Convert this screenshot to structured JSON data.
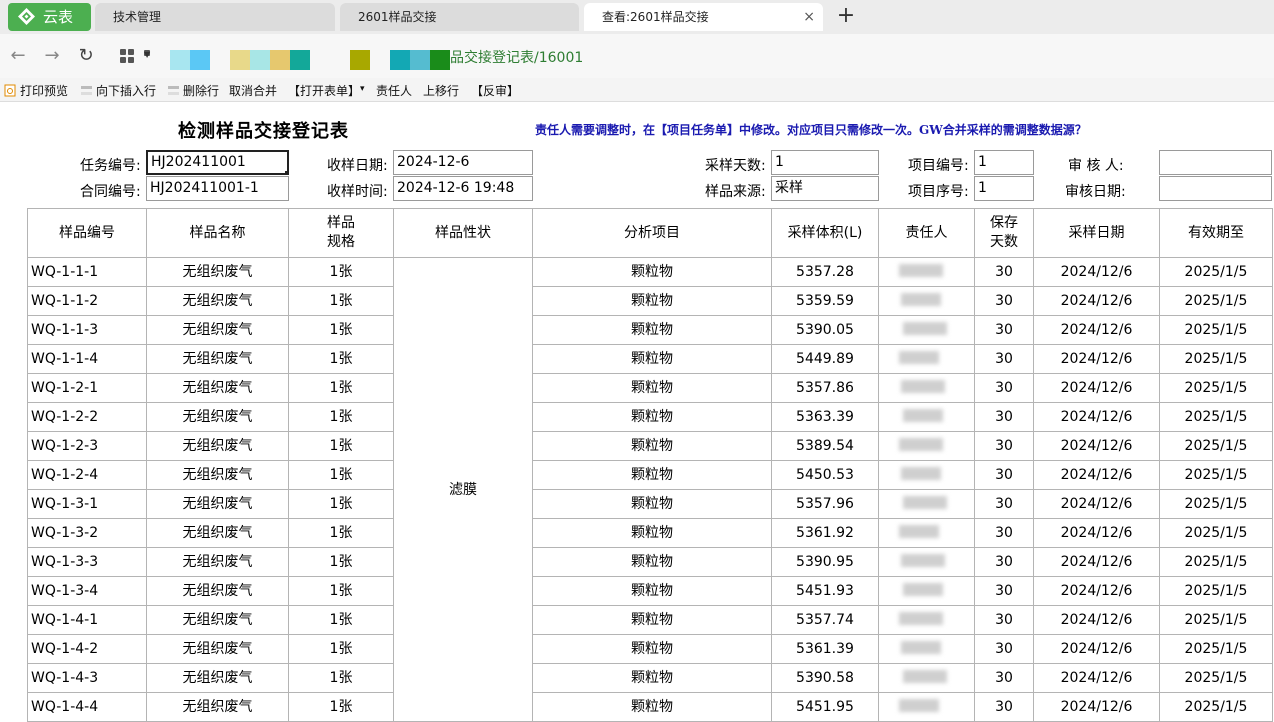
{
  "tabs": {
    "logo_text": "云表",
    "items": [
      {
        "label": "技术管理"
      },
      {
        "label": "2601样品交接"
      },
      {
        "label": "查看:2601样品交接"
      }
    ],
    "close_icon": "×",
    "new_tab_icon": "+"
  },
  "nav": {
    "back_icon": "←",
    "forward_icon": "→",
    "refresh_icon": "↻",
    "address": "品交接登记表/16001",
    "colors": [
      "#a8e6f0",
      "#5bc8f5",
      "#e8d98a",
      "#a8e6e6",
      "#e6c86e",
      "#13a899",
      "#a8a800",
      "#13a8b4",
      "#55bcd0",
      "#1eaa8c",
      "#1a8c1a"
    ]
  },
  "toolbar": {
    "items": [
      {
        "label": "打印预览",
        "icon": "print-preview-icon"
      },
      {
        "label": "向下插入行",
        "icon": "insert-row-icon"
      },
      {
        "label": "删除行",
        "icon": "delete-row-icon"
      },
      {
        "label": "取消合并"
      },
      {
        "label": "【打开表单】"
      },
      {
        "label": "▾"
      },
      {
        "label": "责任人"
      },
      {
        "label": "上移行"
      },
      {
        "label": "【反审】"
      }
    ]
  },
  "form": {
    "title": "检测样品交接登记表",
    "notice": "责任人需要调整时，在【项目任务单】中修改。对应项目只需修改一次。GW合并采样的需调整数据源？",
    "task_no_label": "任务编号:",
    "task_no": "HJ202411001",
    "contract_no_label": "合同编号:",
    "contract_no": "HJ202411001-1",
    "receive_date_label": "收样日期:",
    "receive_date": "2024-12-6",
    "receive_time_label": "收样时间:",
    "receive_time": "2024-12-6 19:48",
    "sampling_days_label": "采样天数:",
    "sampling_days": "1",
    "sample_source_label": "样品来源:",
    "sample_source": "采样",
    "project_no_label": "项目编号:",
    "project_no": "1",
    "project_seq_label": "项目序号:",
    "project_seq": "1",
    "reviewer_label": "审 核 人:",
    "reviewer": "",
    "review_date_label": "审核日期:",
    "review_date": ""
  },
  "table": {
    "headers": {
      "sample_no": "样品编号",
      "sample_name": "样品名称",
      "spec_line1": "样品",
      "spec_line2": "规格",
      "shape": "样品性状",
      "analysis": "分析项目",
      "volume": "采样体积(L)",
      "owner": "责任人",
      "keep_line1": "保存",
      "keep_line2": "天数",
      "sample_date": "采样日期",
      "valid_until": "有效期至"
    },
    "shape_merged": "滤膜",
    "rows": [
      {
        "no": "WQ-1-1-1",
        "name": "无组织废气",
        "spec": "1张",
        "analysis": "颗粒物",
        "volume": "5357.28",
        "keep": "30",
        "date": "2024/12/6",
        "valid": "2025/1/5"
      },
      {
        "no": "WQ-1-1-2",
        "name": "无组织废气",
        "spec": "1张",
        "analysis": "颗粒物",
        "volume": "5359.59",
        "keep": "30",
        "date": "2024/12/6",
        "valid": "2025/1/5"
      },
      {
        "no": "WQ-1-1-3",
        "name": "无组织废气",
        "spec": "1张",
        "analysis": "颗粒物",
        "volume": "5390.05",
        "keep": "30",
        "date": "2024/12/6",
        "valid": "2025/1/5"
      },
      {
        "no": "WQ-1-1-4",
        "name": "无组织废气",
        "spec": "1张",
        "analysis": "颗粒物",
        "volume": "5449.89",
        "keep": "30",
        "date": "2024/12/6",
        "valid": "2025/1/5"
      },
      {
        "no": "WQ-1-2-1",
        "name": "无组织废气",
        "spec": "1张",
        "analysis": "颗粒物",
        "volume": "5357.86",
        "keep": "30",
        "date": "2024/12/6",
        "valid": "2025/1/5"
      },
      {
        "no": "WQ-1-2-2",
        "name": "无组织废气",
        "spec": "1张",
        "analysis": "颗粒物",
        "volume": "5363.39",
        "keep": "30",
        "date": "2024/12/6",
        "valid": "2025/1/5"
      },
      {
        "no": "WQ-1-2-3",
        "name": "无组织废气",
        "spec": "1张",
        "analysis": "颗粒物",
        "volume": "5389.54",
        "keep": "30",
        "date": "2024/12/6",
        "valid": "2025/1/5"
      },
      {
        "no": "WQ-1-2-4",
        "name": "无组织废气",
        "spec": "1张",
        "analysis": "颗粒物",
        "volume": "5450.53",
        "keep": "30",
        "date": "2024/12/6",
        "valid": "2025/1/5"
      },
      {
        "no": "WQ-1-3-1",
        "name": "无组织废气",
        "spec": "1张",
        "analysis": "颗粒物",
        "volume": "5357.96",
        "keep": "30",
        "date": "2024/12/6",
        "valid": "2025/1/5"
      },
      {
        "no": "WQ-1-3-2",
        "name": "无组织废气",
        "spec": "1张",
        "analysis": "颗粒物",
        "volume": "5361.92",
        "keep": "30",
        "date": "2024/12/6",
        "valid": "2025/1/5"
      },
      {
        "no": "WQ-1-3-3",
        "name": "无组织废气",
        "spec": "1张",
        "analysis": "颗粒物",
        "volume": "5390.95",
        "keep": "30",
        "date": "2024/12/6",
        "valid": "2025/1/5"
      },
      {
        "no": "WQ-1-3-4",
        "name": "无组织废气",
        "spec": "1张",
        "analysis": "颗粒物",
        "volume": "5451.93",
        "keep": "30",
        "date": "2024/12/6",
        "valid": "2025/1/5"
      },
      {
        "no": "WQ-1-4-1",
        "name": "无组织废气",
        "spec": "1张",
        "analysis": "颗粒物",
        "volume": "5357.74",
        "keep": "30",
        "date": "2024/12/6",
        "valid": "2025/1/5"
      },
      {
        "no": "WQ-1-4-2",
        "name": "无组织废气",
        "spec": "1张",
        "analysis": "颗粒物",
        "volume": "5361.39",
        "keep": "30",
        "date": "2024/12/6",
        "valid": "2025/1/5"
      },
      {
        "no": "WQ-1-4-3",
        "name": "无组织废气",
        "spec": "1张",
        "analysis": "颗粒物",
        "volume": "5390.58",
        "keep": "30",
        "date": "2024/12/6",
        "valid": "2025/1/5"
      },
      {
        "no": "WQ-1-4-4",
        "name": "无组织废气",
        "spec": "1张",
        "analysis": "颗粒物",
        "volume": "5451.95",
        "keep": "30",
        "date": "2024/12/6",
        "valid": "2025/1/5"
      }
    ]
  }
}
